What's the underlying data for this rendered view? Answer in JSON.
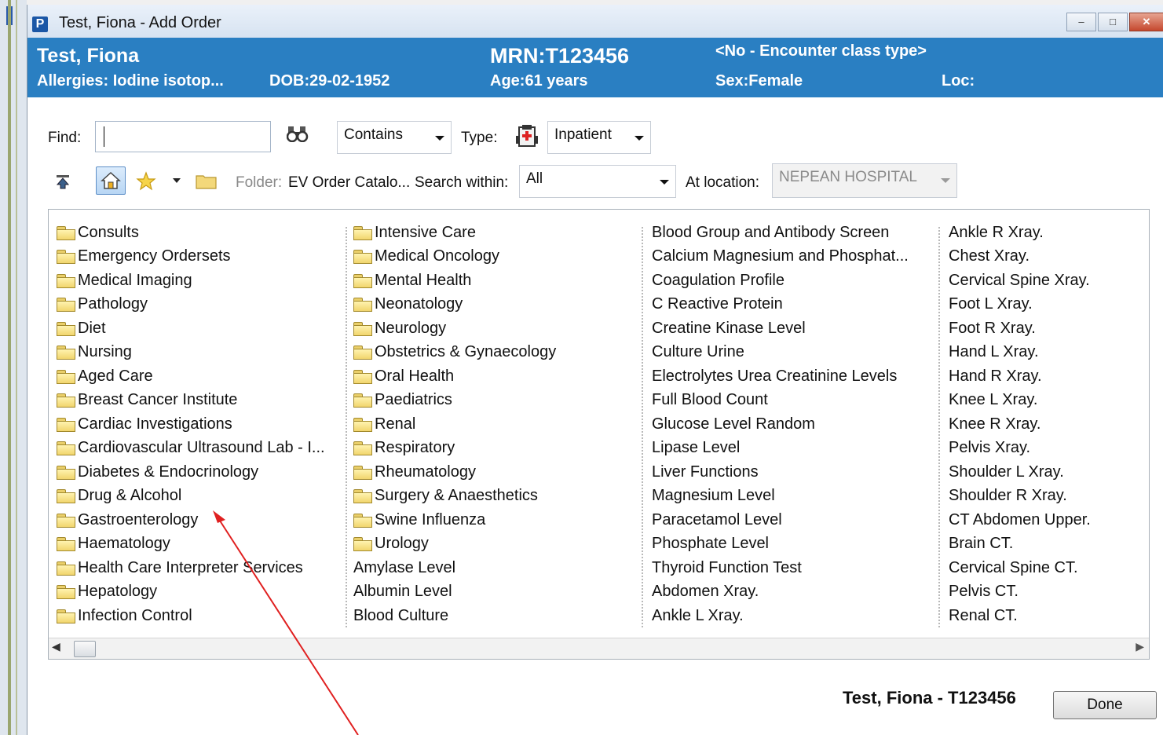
{
  "window": {
    "app_icon_letter": "P",
    "title": "Test, Fiona - Add Order",
    "buttons": {
      "minimize": "–",
      "maximize": "□",
      "close": "✕"
    }
  },
  "banner": {
    "patient_name": "Test, Fiona",
    "allergies": "Allergies:  Iodine isotop...",
    "dob": "DOB:29-02-1952",
    "mrn": "MRN:T123456",
    "age": "Age:61 years",
    "encounter": "<No - Encounter class type>",
    "sex": "Sex:Female",
    "loc": "Loc:"
  },
  "search": {
    "find_label": "Find:",
    "find_value": "",
    "match_mode": "Contains",
    "type_label": "Type:",
    "type_value": "Inpatient"
  },
  "toolbar": {
    "folder_label": "Folder:",
    "folder_value": "EV Order Catalo...",
    "search_within_label": "Search within:",
    "search_within_value": "All",
    "at_location_label": "At location:",
    "at_location_value": "NEPEAN HOSPITAL"
  },
  "catalog": {
    "column1": [
      {
        "label": "Consults",
        "folder": true
      },
      {
        "label": "Emergency Ordersets",
        "folder": true
      },
      {
        "label": "Medical Imaging",
        "folder": true
      },
      {
        "label": "Pathology",
        "folder": true
      },
      {
        "label": "Diet",
        "folder": true
      },
      {
        "label": "Nursing",
        "folder": true
      },
      {
        "label": "Aged Care",
        "folder": true
      },
      {
        "label": "Breast Cancer Institute",
        "folder": true
      },
      {
        "label": "Cardiac Investigations",
        "folder": true
      },
      {
        "label": "Cardiovascular Ultrasound Lab - I...",
        "folder": true
      },
      {
        "label": "Diabetes & Endocrinology",
        "folder": true
      },
      {
        "label": "Drug & Alcohol",
        "folder": true
      },
      {
        "label": "Gastroenterology",
        "folder": true
      },
      {
        "label": "Haematology",
        "folder": true
      },
      {
        "label": "Health Care Interpreter Services",
        "folder": true
      },
      {
        "label": "Hepatology",
        "folder": true
      },
      {
        "label": "Infection Control",
        "folder": true
      }
    ],
    "column2": [
      {
        "label": "Intensive Care",
        "folder": true
      },
      {
        "label": "Medical Oncology",
        "folder": true
      },
      {
        "label": "Mental Health",
        "folder": true
      },
      {
        "label": "Neonatology",
        "folder": true
      },
      {
        "label": "Neurology",
        "folder": true
      },
      {
        "label": "Obstetrics & Gynaecology",
        "folder": true
      },
      {
        "label": "Oral Health",
        "folder": true
      },
      {
        "label": "Paediatrics",
        "folder": true
      },
      {
        "label": "Renal",
        "folder": true
      },
      {
        "label": "Respiratory",
        "folder": true
      },
      {
        "label": "Rheumatology",
        "folder": true
      },
      {
        "label": "Surgery & Anaesthetics",
        "folder": true
      },
      {
        "label": "Swine Influenza",
        "folder": true
      },
      {
        "label": "Urology",
        "folder": true
      },
      {
        "label": "Amylase Level",
        "folder": false
      },
      {
        "label": "Albumin Level",
        "folder": false
      },
      {
        "label": "Blood Culture",
        "folder": false
      }
    ],
    "column3": [
      {
        "label": "Blood Group and Antibody Screen",
        "folder": false
      },
      {
        "label": "Calcium Magnesium and Phosphat...",
        "folder": false
      },
      {
        "label": "Coagulation Profile",
        "folder": false
      },
      {
        "label": "C Reactive Protein",
        "folder": false
      },
      {
        "label": "Creatine Kinase Level",
        "folder": false
      },
      {
        "label": "Culture Urine",
        "folder": false
      },
      {
        "label": "Electrolytes Urea Creatinine Levels",
        "folder": false
      },
      {
        "label": "Full Blood Count",
        "folder": false
      },
      {
        "label": "Glucose Level Random",
        "folder": false
      },
      {
        "label": "Lipase Level",
        "folder": false
      },
      {
        "label": "Liver Functions",
        "folder": false
      },
      {
        "label": "Magnesium Level",
        "folder": false
      },
      {
        "label": "Paracetamol Level",
        "folder": false
      },
      {
        "label": "Phosphate Level",
        "folder": false
      },
      {
        "label": "Thyroid Function Test",
        "folder": false
      },
      {
        "label": "Abdomen Xray.",
        "folder": false
      },
      {
        "label": "Ankle L Xray.",
        "folder": false
      }
    ],
    "column4": [
      {
        "label": "Ankle R Xray.",
        "folder": false
      },
      {
        "label": "Chest Xray.",
        "folder": false
      },
      {
        "label": "Cervical Spine Xray.",
        "folder": false
      },
      {
        "label": "Foot L Xray.",
        "folder": false
      },
      {
        "label": "Foot R Xray.",
        "folder": false
      },
      {
        "label": "Hand L Xray.",
        "folder": false
      },
      {
        "label": "Hand R Xray.",
        "folder": false
      },
      {
        "label": "Knee L Xray.",
        "folder": false
      },
      {
        "label": "Knee R Xray.",
        "folder": false
      },
      {
        "label": "Pelvis Xray.",
        "folder": false
      },
      {
        "label": "Shoulder L Xray.",
        "folder": false
      },
      {
        "label": "Shoulder R Xray.",
        "folder": false
      },
      {
        "label": "CT Abdomen Upper.",
        "folder": false
      },
      {
        "label": "Brain CT.",
        "folder": false
      },
      {
        "label": "Cervical Spine CT.",
        "folder": false
      },
      {
        "label": "Pelvis CT.",
        "folder": false
      },
      {
        "label": "Renal CT.",
        "folder": false
      }
    ]
  },
  "footer": {
    "patient_id": "Test, Fiona - T123456",
    "done_label": "Done"
  },
  "colors": {
    "banner": "#2a7fc2",
    "annotation_arrow": "#e02020"
  }
}
